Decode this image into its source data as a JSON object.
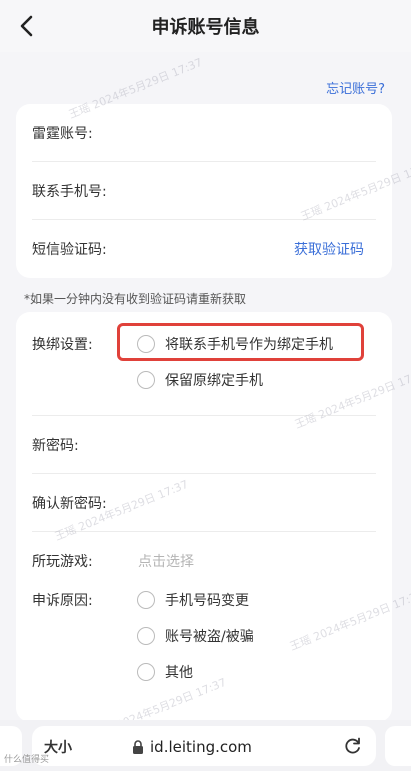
{
  "header": {
    "title": "申诉账号信息"
  },
  "forgot_link": "忘记账号?",
  "account_card": {
    "rows": [
      {
        "label": "雷霆账号:"
      },
      {
        "label": "联系手机号:"
      },
      {
        "label": "短信验证码:",
        "action": "获取验证码"
      }
    ]
  },
  "hint": "*如果一分钟内没有收到验证码请重新获取",
  "settings_card": {
    "rebind": {
      "label": "换绑设置:",
      "options": [
        "将联系手机号作为绑定手机",
        "保留原绑定手机"
      ]
    },
    "new_password": {
      "label": "新密码:"
    },
    "confirm_password": {
      "label": "确认新密码:"
    },
    "game": {
      "label": "所玩游戏:",
      "placeholder": "点击选择"
    },
    "reason": {
      "label": "申诉原因:",
      "options": [
        "手机号码变更",
        "账号被盗/被骗",
        "其他"
      ]
    }
  },
  "watermark_text": "王瑶 2024年5月29日 17:37",
  "browser": {
    "text_size": "大小",
    "url": "id.leiting.com"
  },
  "corner_text": "什么值得买",
  "colors": {
    "link": "#3b6fd8",
    "highlight": "#e0413a"
  }
}
